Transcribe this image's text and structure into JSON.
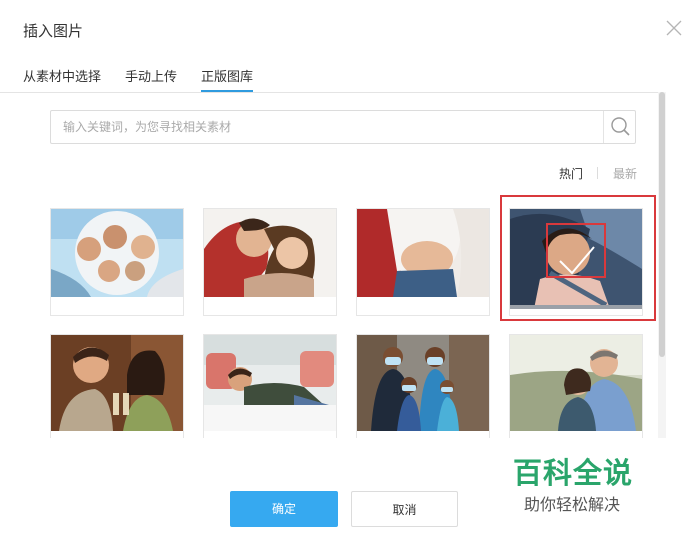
{
  "dialog": {
    "title": "插入图片",
    "close_icon": "close-icon"
  },
  "tabs": [
    {
      "label": "从素材中选择",
      "active": false
    },
    {
      "label": "手动上传",
      "active": false
    },
    {
      "label": "正版图库",
      "active": true
    }
  ],
  "colors": {
    "accent": "#2f9bdf",
    "confirm_button": "#36a9f0",
    "selection_border": "#d9393c",
    "watermark_green": "#2aa56b"
  },
  "search": {
    "placeholder": "输入关键词，为您寻找相关素材",
    "value": "",
    "icon": "search-icon"
  },
  "sort": {
    "hot_label": "热门",
    "new_label": "最新",
    "active": "热门"
  },
  "gallery": {
    "selected_index": 3,
    "images": [
      {
        "name": "family-circle-photo"
      },
      {
        "name": "couple-hug-photo"
      },
      {
        "name": "pregnant-couple-photo"
      },
      {
        "name": "child-in-car-photo"
      },
      {
        "name": "couple-toast-photo"
      },
      {
        "name": "man-on-bed-photo"
      },
      {
        "name": "family-masks-photo"
      },
      {
        "name": "senior-couple-photo"
      }
    ]
  },
  "buttons": {
    "confirm_label": "确定",
    "cancel_label": "取消"
  },
  "watermark": {
    "title": "百科全说",
    "subtitle": "助你轻松解决"
  }
}
